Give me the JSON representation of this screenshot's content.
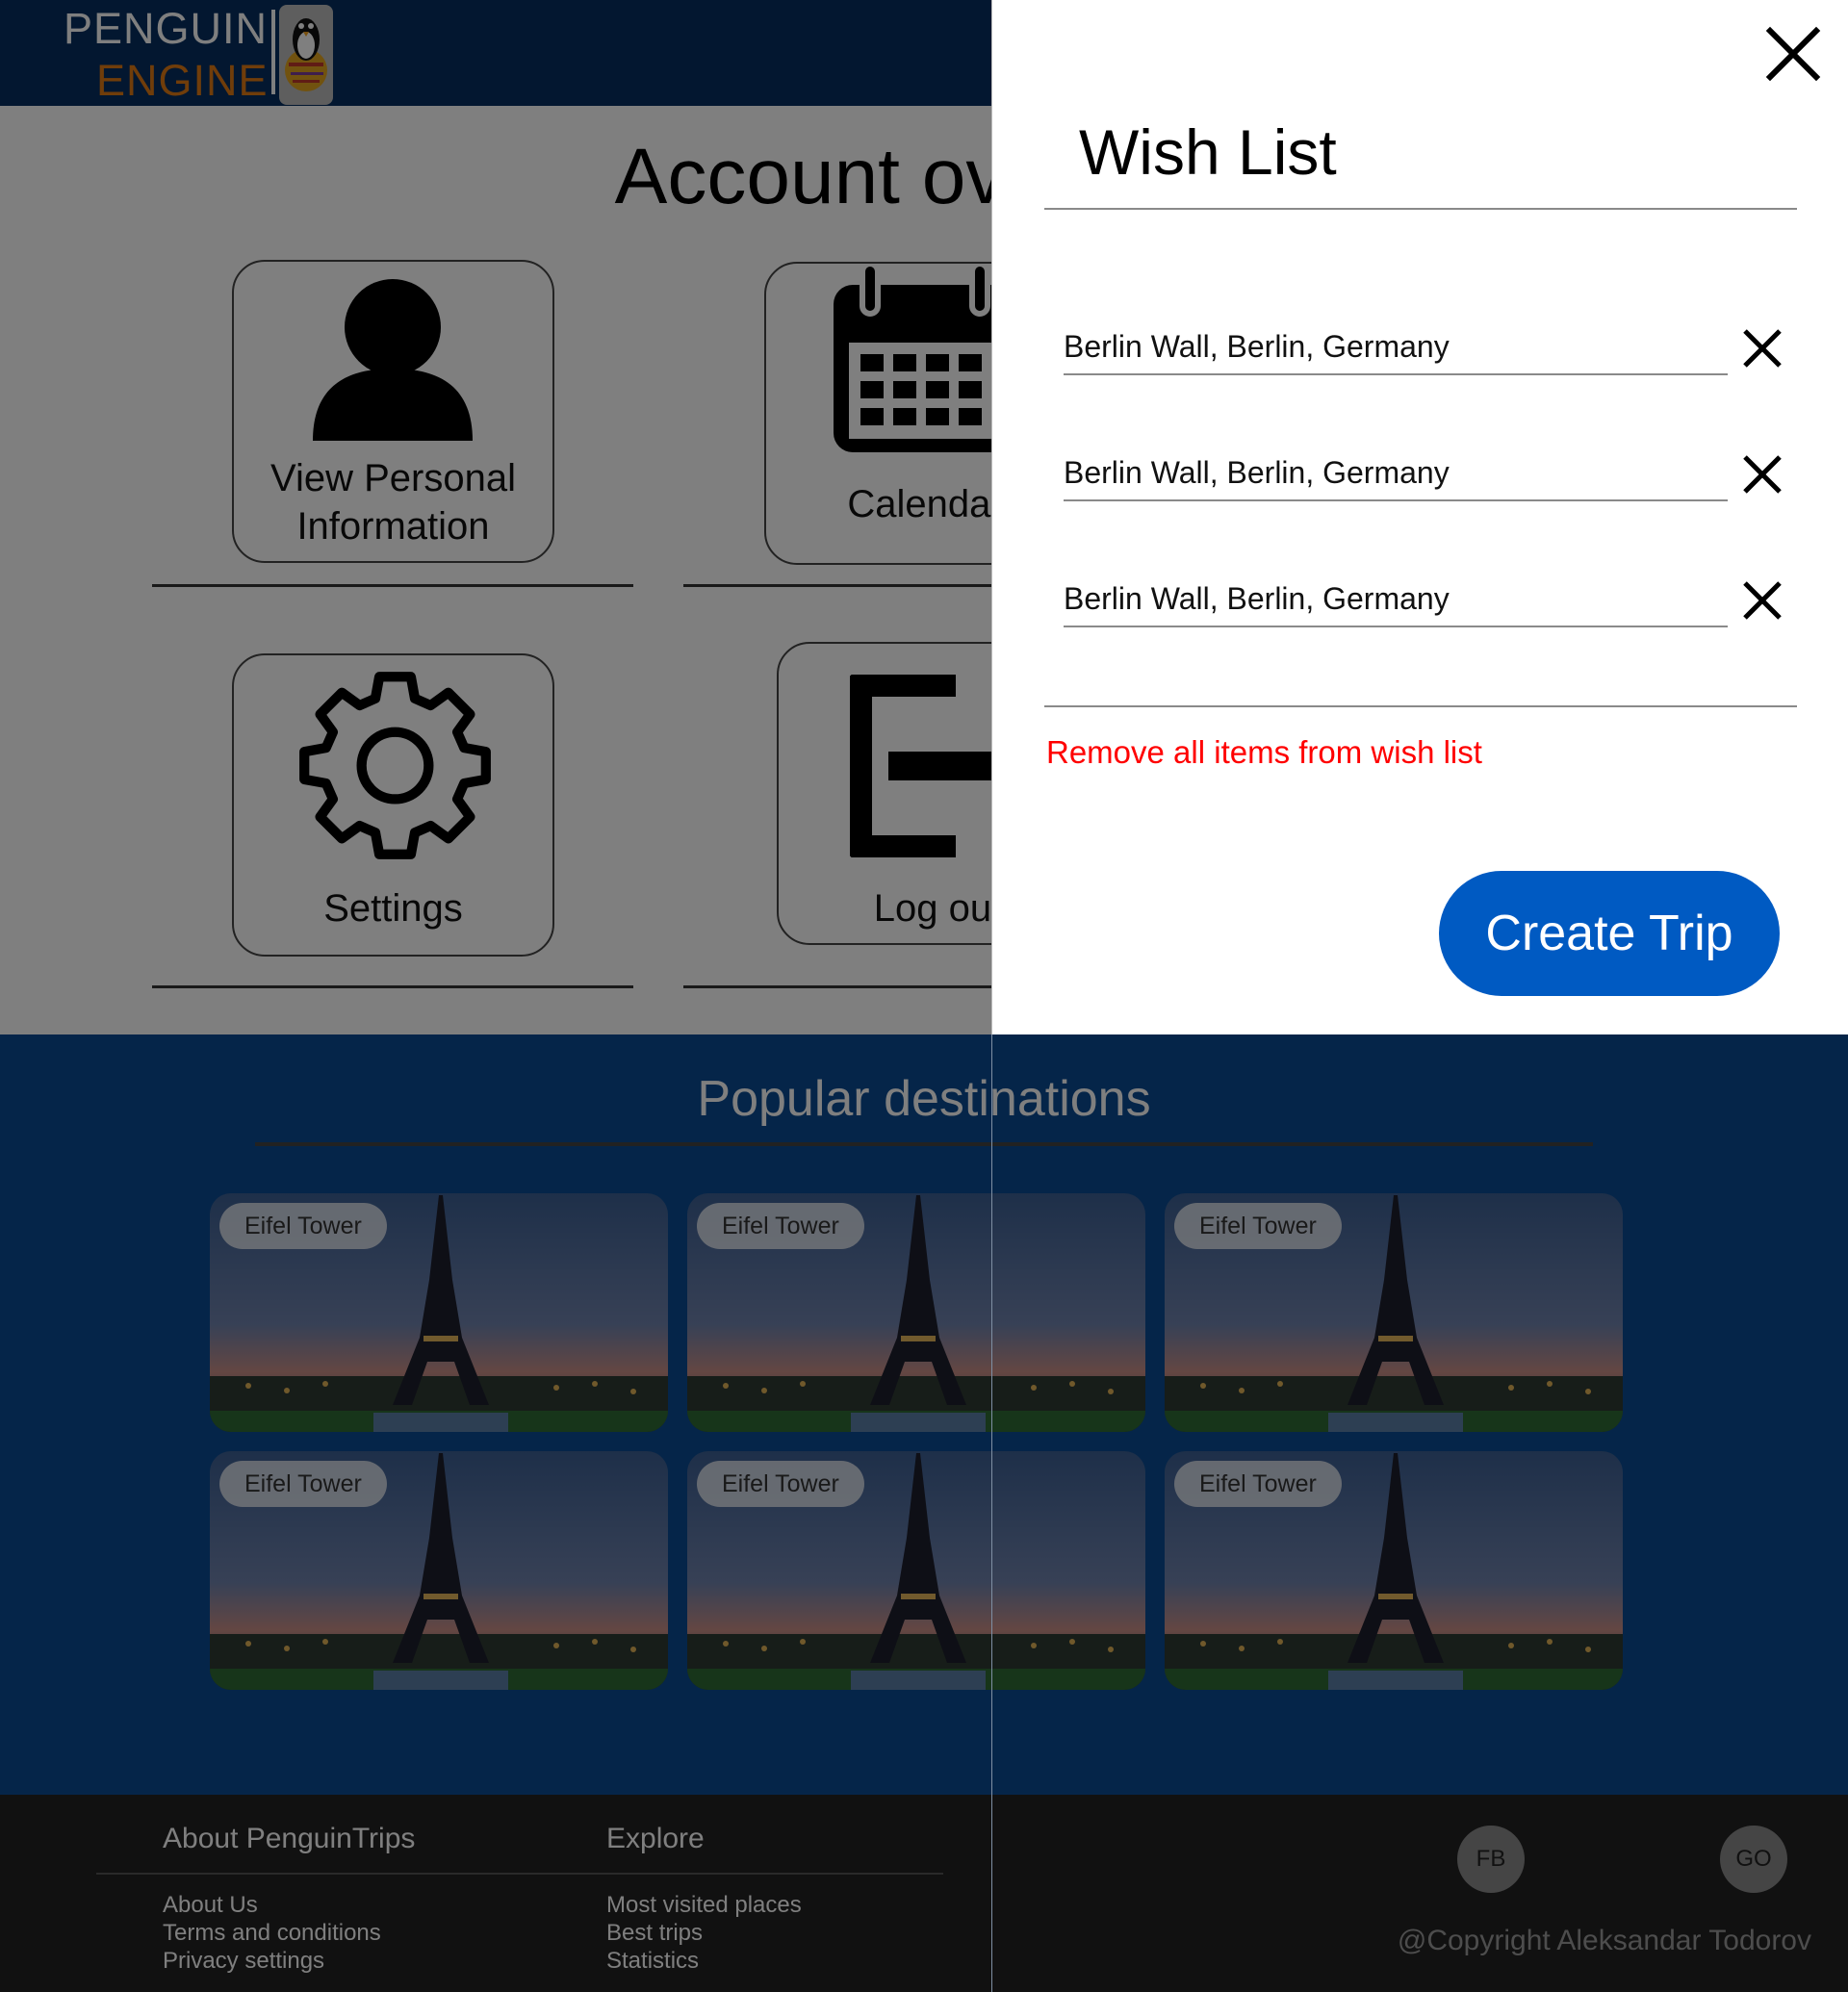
{
  "header": {
    "logo_word1": "PENGUIN",
    "logo_word2": "ENGINE",
    "bg_color": "#062f60"
  },
  "account": {
    "title": "Account overview",
    "tiles": [
      {
        "label": "View Personal Information",
        "icon": "user-icon"
      },
      {
        "label": "Calendar",
        "icon": "calendar-icon"
      },
      {
        "label": "Settings",
        "icon": "gear-icon"
      },
      {
        "label": "Log out",
        "icon": "logout-icon"
      }
    ]
  },
  "popular": {
    "title": "Popular destinations",
    "destinations": [
      {
        "label": "Eifel Tower"
      },
      {
        "label": "Eifel Tower"
      },
      {
        "label": "Eifel Tower"
      },
      {
        "label": "Eifel Tower"
      },
      {
        "label": "Eifel Tower"
      },
      {
        "label": "Eifel Tower"
      }
    ]
  },
  "footer": {
    "about_heading": "About PenguinTrips",
    "about_links": [
      "About Us",
      "Terms and conditions",
      "Privacy settings"
    ],
    "explore_heading": "Explore",
    "explore_links": [
      "Most visited places",
      "Best trips",
      "Statistics"
    ],
    "social": [
      "FB",
      "GO"
    ],
    "copyright": "@Copyright Aleksandar Todorov"
  },
  "drawer": {
    "title": "Wish List",
    "items": [
      {
        "text": "Berlin Wall, Berlin, Germany"
      },
      {
        "text": "Berlin Wall, Berlin, Germany"
      },
      {
        "text": "Berlin Wall, Berlin, Germany"
      }
    ],
    "remove_all_label": "Remove all items from wish list",
    "create_trip_label": "Create Trip",
    "accent_color": "#005ac2",
    "danger_color": "#ff0000"
  }
}
